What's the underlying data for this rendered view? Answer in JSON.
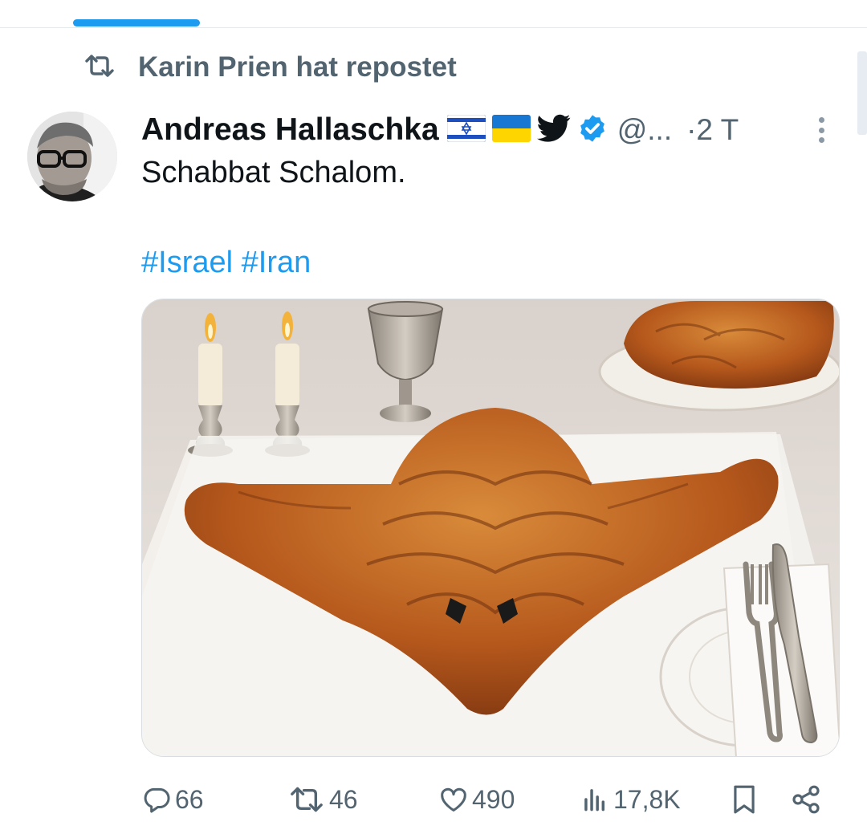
{
  "repost": {
    "label": "Karin Prien hat repostet",
    "icon": "repost-icon"
  },
  "author": {
    "name": "Andreas Hallaschka",
    "handle": "@...",
    "time": "·2 T",
    "badges": [
      "israel-flag",
      "ukraine-flag",
      "twitter-bird",
      "verified-badge"
    ]
  },
  "tweet": {
    "text": "Schabbat Schalom.",
    "hashtags": [
      "#Israel",
      "#Iran"
    ]
  },
  "media": {
    "description_icon": "photo"
  },
  "stats": {
    "replies": "66",
    "reposts": "46",
    "likes": "490",
    "views": "17,8K"
  },
  "colors": {
    "accent": "#1d9bf0",
    "muted": "#536471",
    "text": "#0f1419"
  }
}
